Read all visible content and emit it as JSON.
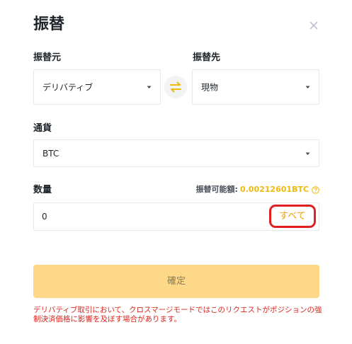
{
  "dialog": {
    "title": "振替",
    "close_icon": "close-icon"
  },
  "from": {
    "label": "振替元",
    "value": "デリバティブ"
  },
  "to": {
    "label": "振替先",
    "value": "現物"
  },
  "swap": {
    "icon": "swap-arrows-icon",
    "color": "#f0b90b"
  },
  "currency": {
    "label": "通貨",
    "value": "BTC"
  },
  "amount": {
    "label": "数量",
    "available_label": "振替可能額:",
    "available_value": "0.00212601BTC",
    "help_icon": "question-icon",
    "input_value": "0",
    "all_label": "すべて"
  },
  "confirm": {
    "label": "確定"
  },
  "warning": {
    "text": "デリバティブ取引において、クロスマージモードではこのリクエストがポジションの強制決済価格に影響を及ぼす場合があります。"
  },
  "colors": {
    "accent": "#f0b90b",
    "button_disabled": "#fdd888",
    "warning": "#d9281f",
    "highlight_border": "#e02020"
  }
}
